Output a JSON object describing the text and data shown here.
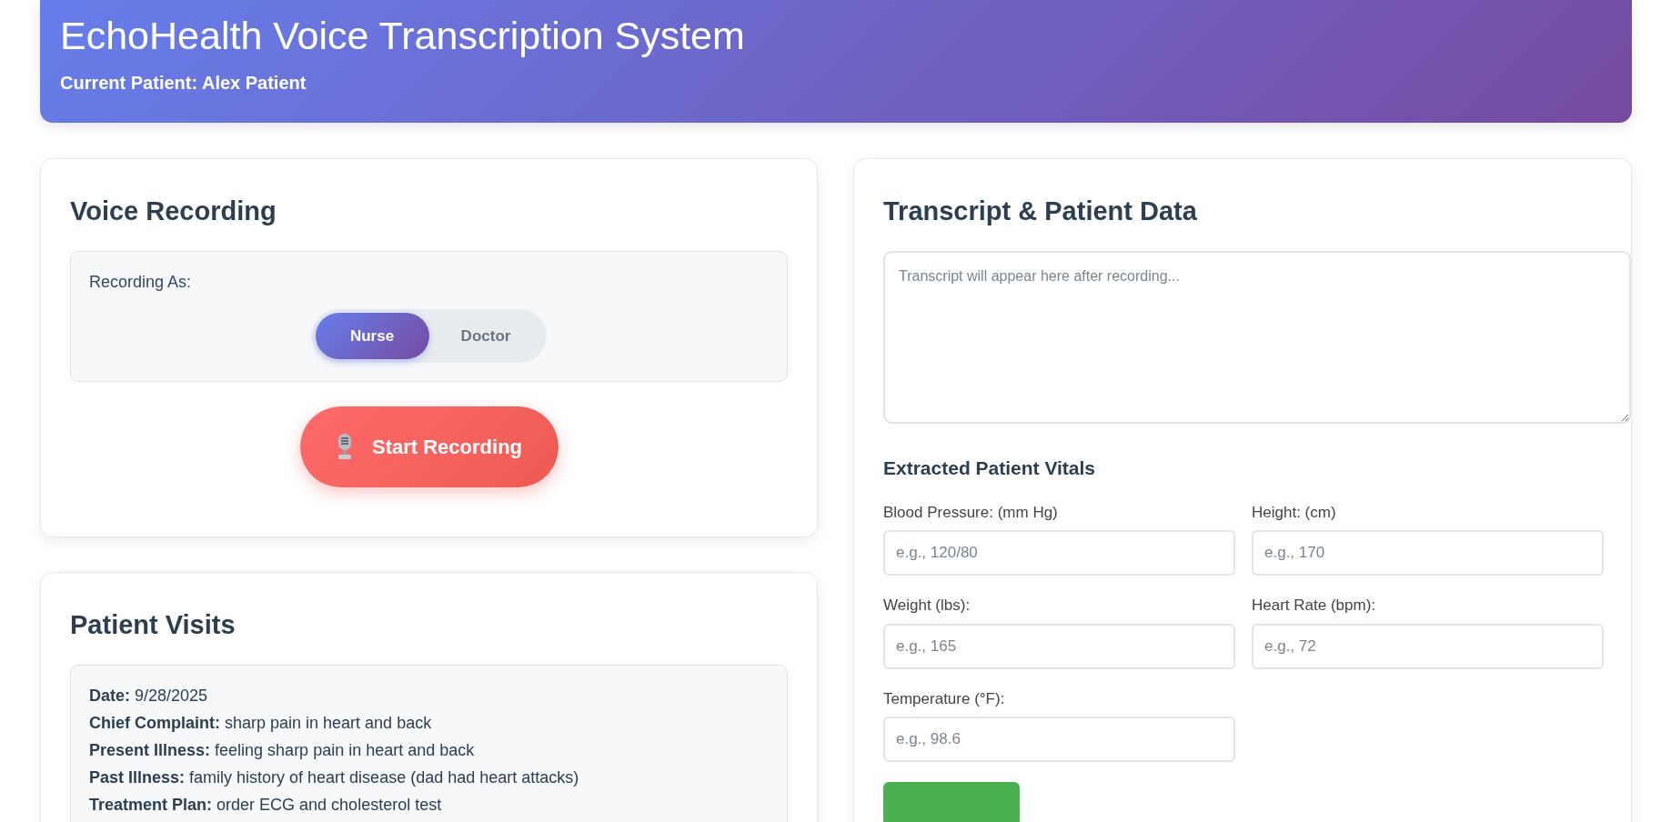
{
  "header": {
    "title": "EchoHealth Voice Transcription System",
    "patient_line": "Current Patient: Alex Patient"
  },
  "recording": {
    "title": "Voice Recording",
    "role_label": "Recording As:",
    "roles": [
      {
        "label": "Nurse",
        "selected": true
      },
      {
        "label": "Doctor",
        "selected": false
      }
    ],
    "record_button": "Start Recording"
  },
  "visits": {
    "title": "Patient Visits",
    "lines": [
      "**Date:** 9/28/2025",
      "**Chief Complaint:** sharp pain in heart and back",
      "**Present Illness:** feeling sharp pain in heart and back",
      "**Past Illness:** family history of heart disease (dad had heart attacks)",
      "**Treatment Plan:** order ECG and cholesterol test"
    ]
  },
  "transcript": {
    "title": "Transcript & Patient Data",
    "placeholder": "Transcript will appear here after recording...",
    "vitals_title": "Extracted Patient Vitals",
    "fields": [
      {
        "label": "Blood Pressure: (mm Hg)",
        "placeholder": "e.g., 120/80"
      },
      {
        "label": "Height: (cm)",
        "placeholder": "e.g., 170"
      },
      {
        "label": "Weight (lbs):",
        "placeholder": "e.g., 165"
      },
      {
        "label": "Heart Rate (bpm):",
        "placeholder": "e.g., 72"
      },
      {
        "label": "Temperature (°F):",
        "placeholder": "e.g., 98.6"
      }
    ]
  }
}
